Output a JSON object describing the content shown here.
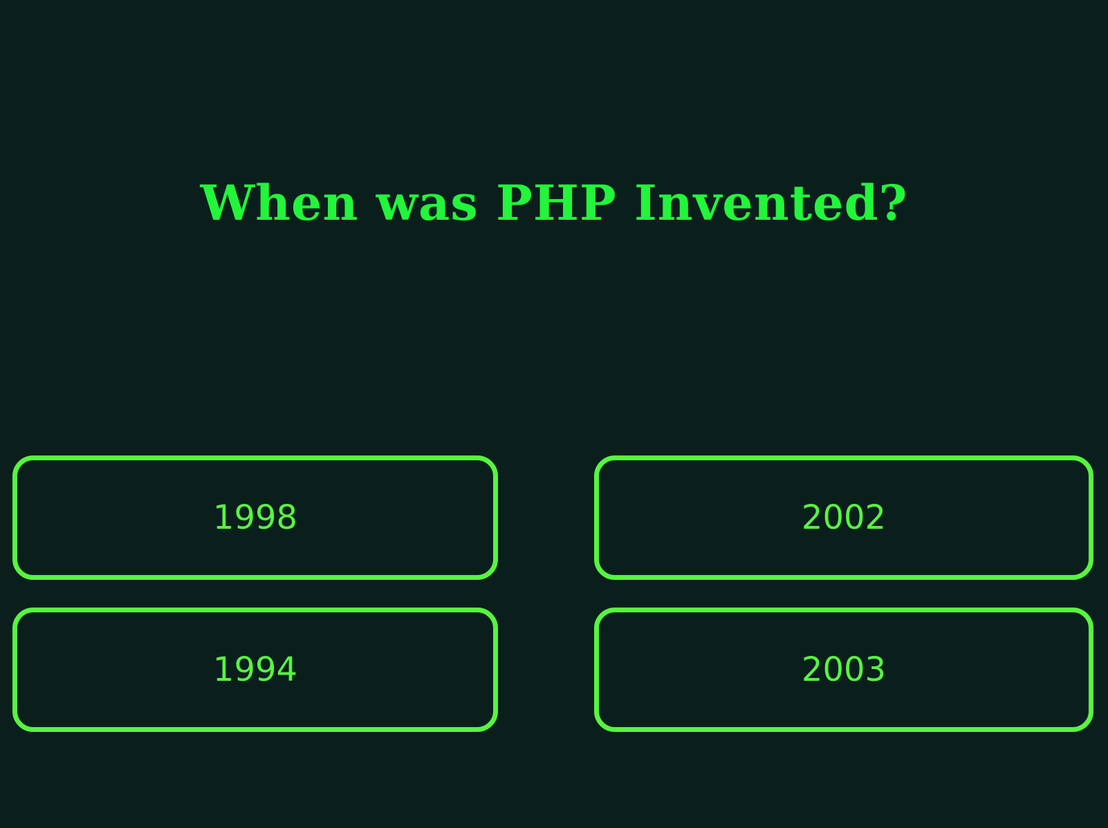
{
  "question": {
    "text": "When was PHP Invented?"
  },
  "answers": [
    {
      "label": "1998"
    },
    {
      "label": "2002"
    },
    {
      "label": "1994"
    },
    {
      "label": "2003"
    }
  ],
  "colors": {
    "background": "#0a1f1c",
    "question_text": "#22f53a",
    "answer_accent": "#57f53f"
  }
}
